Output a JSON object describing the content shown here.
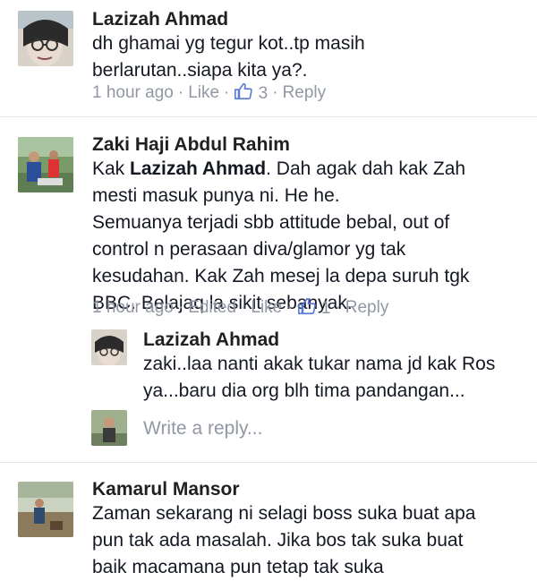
{
  "comments": [
    {
      "author": "Lazizah Ahmad",
      "lines": [
        "dh ghamai yg tegur kot..tp masih",
        "berlarutan..siapa kita ya?."
      ],
      "time": "1 hour ago",
      "like_label": "Like",
      "like_count": "3",
      "reply_label": "Reply"
    },
    {
      "author": "Zaki Haji Abdul Rahim",
      "mention": "Lazizah Ahmad",
      "line1_prefix": "Kak ",
      "line1_suffix": ". Dah agak dah kak Zah",
      "lines": [
        "mesti masuk punya ni. He he.",
        "Semuanya terjadi sbb attitude bebal, out of",
        "control n perasaan diva/glamor yg tak",
        "kesudahan. Kak Zah mesej la depa suruh tgk",
        "BBC. Belajaq la sikit sebanyak."
      ],
      "time": "1 hour ago",
      "edited_label": "Edited",
      "like_label": "Like",
      "like_count": "1",
      "reply_label": "Reply"
    }
  ],
  "reply": {
    "author": "Lazizah Ahmad",
    "lines": [
      "zaki..laa nanti akak tukar nama jd kak Ros",
      "ya...baru dia org blh tima pandangan..."
    ]
  },
  "write_reply": {
    "placeholder": "Write a reply..."
  },
  "comment3": {
    "author": "Kamarul Mansor",
    "lines": [
      "Zaman sekarang ni selagi boss suka buat apa",
      "pun tak ada masalah. Jika bos tak suka buat",
      "baik macamana pun tetap tak suka"
    ]
  },
  "colors": {
    "meta": "#9197a3",
    "name": "#202020",
    "divider": "#e5e5e5"
  }
}
